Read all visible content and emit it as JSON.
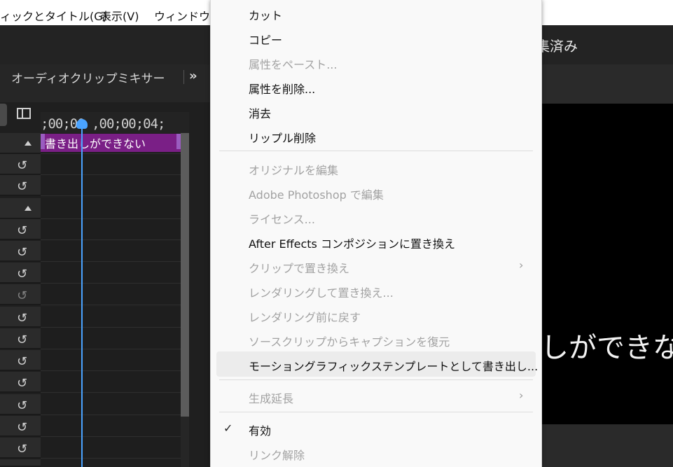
{
  "menubar": {
    "items": [
      "ィックとタイトル(G)",
      "表示(V)",
      "ウィンドウ(V"
    ]
  },
  "right_panel": {
    "title": "集済み",
    "viewer_caption": "しができな"
  },
  "left_panel": {
    "title": "オーディオクリップミキサー",
    "expand_label": "»",
    "ruler_timecode": ";00;00 ,00;00;04;",
    "clip_label": "書き出しができない"
  },
  "context_menu": {
    "items": [
      {
        "label": "カット",
        "enabled": true
      },
      {
        "label": "コピー",
        "enabled": true
      },
      {
        "label": "属性をペースト...",
        "enabled": false
      },
      {
        "label": "属性を削除...",
        "enabled": true
      },
      {
        "label": "消去",
        "enabled": true
      },
      {
        "label": "リップル削除",
        "enabled": true
      },
      {
        "label": "オリジナルを編集",
        "enabled": false
      },
      {
        "label": "Adobe Photoshop で編集",
        "enabled": false
      },
      {
        "label": "ライセンス...",
        "enabled": false
      },
      {
        "label": "After Effects コンポジションに置き換え",
        "enabled": true
      },
      {
        "label": "クリップで置き換え",
        "enabled": false,
        "submenu": true
      },
      {
        "label": "レンダリングして置き換え...",
        "enabled": false
      },
      {
        "label": "レンダリング前に戻す",
        "enabled": false
      },
      {
        "label": "ソースクリップからキャプションを復元",
        "enabled": false
      },
      {
        "label": "モーショングラフィックステンプレートとして書き出し...",
        "enabled": true,
        "highlighted": true
      },
      {
        "label": "生成延長",
        "enabled": false,
        "submenu": true
      },
      {
        "label": "有効",
        "enabled": true,
        "checked": true
      },
      {
        "label": "リンク解除",
        "enabled": false
      }
    ],
    "submenu_arrow": "›",
    "check_mark": "✓"
  },
  "colors": {
    "clip": "#7a1f86",
    "playhead": "#4aa3ff",
    "menu_bg": "#f9f9f9"
  }
}
